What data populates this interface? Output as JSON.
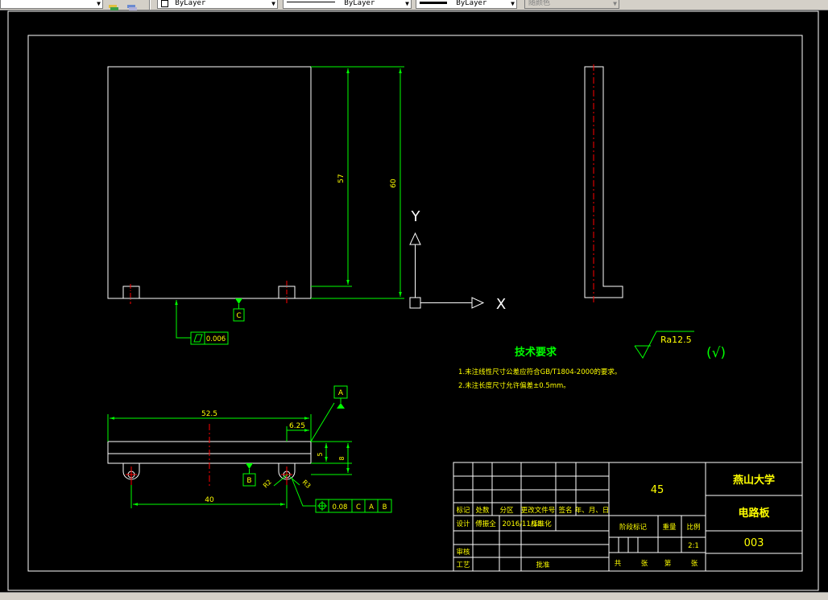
{
  "toolbar": {
    "linetype_value": "ByLayer",
    "lineweight_value": "ByLayer",
    "plotstyle_value": "ByLayer",
    "color_value": "随颜色"
  },
  "drawing": {
    "dim_57": "57",
    "dim_60": "60",
    "datum_c": "C",
    "datum_b": "B",
    "datum_a": "A",
    "flatness_value": "0.006",
    "dim_52_5": "52.5",
    "dim_6_25": "6.25",
    "dim_5": "5",
    "dim_8": "8",
    "dim_40": "40",
    "dim_r2": "R2",
    "dim_r3": "R3",
    "position_tol": "0.08",
    "tol_ref_c": "C",
    "tol_ref_a": "A",
    "tol_ref_b": "B",
    "ucs_y": "Y",
    "ucs_x": "X",
    "tech_title": "技术要求",
    "tech_note_1": "1.未注线性尺寸公差应符合GB/T1804-2000的要求。",
    "tech_note_2": "2.未注长度尺寸允许偏差±0.5mm。",
    "roughness": "Ra12.5",
    "roughness_paren": "(√)"
  },
  "title_block": {
    "material": "45",
    "school": "燕山大学",
    "part_name": "电路板",
    "drawing_no": "003",
    "col_mark": "标记",
    "col_count": "处数",
    "col_zone": "分区",
    "col_doc": "更改文件号",
    "col_sign": "签名",
    "col_date": "年、月、日",
    "design": "设计",
    "designer": "傅振全",
    "design_date": "2016/11/18",
    "standard": "标准化",
    "review": "审核",
    "process": "工艺",
    "approve": "批准",
    "stage_mark": "阶段标记",
    "weight": "重量",
    "scale_label": "比例",
    "scale": "2:1",
    "sheet_total": "共",
    "sheet_zhang_1": "张",
    "sheet_di": "第",
    "sheet_zhang_2": "张"
  },
  "colors": {
    "dimension": "#00ff00",
    "outline": "#ffffff",
    "centerline": "#ff0000",
    "text": "#ffff00",
    "background": "#000000"
  }
}
